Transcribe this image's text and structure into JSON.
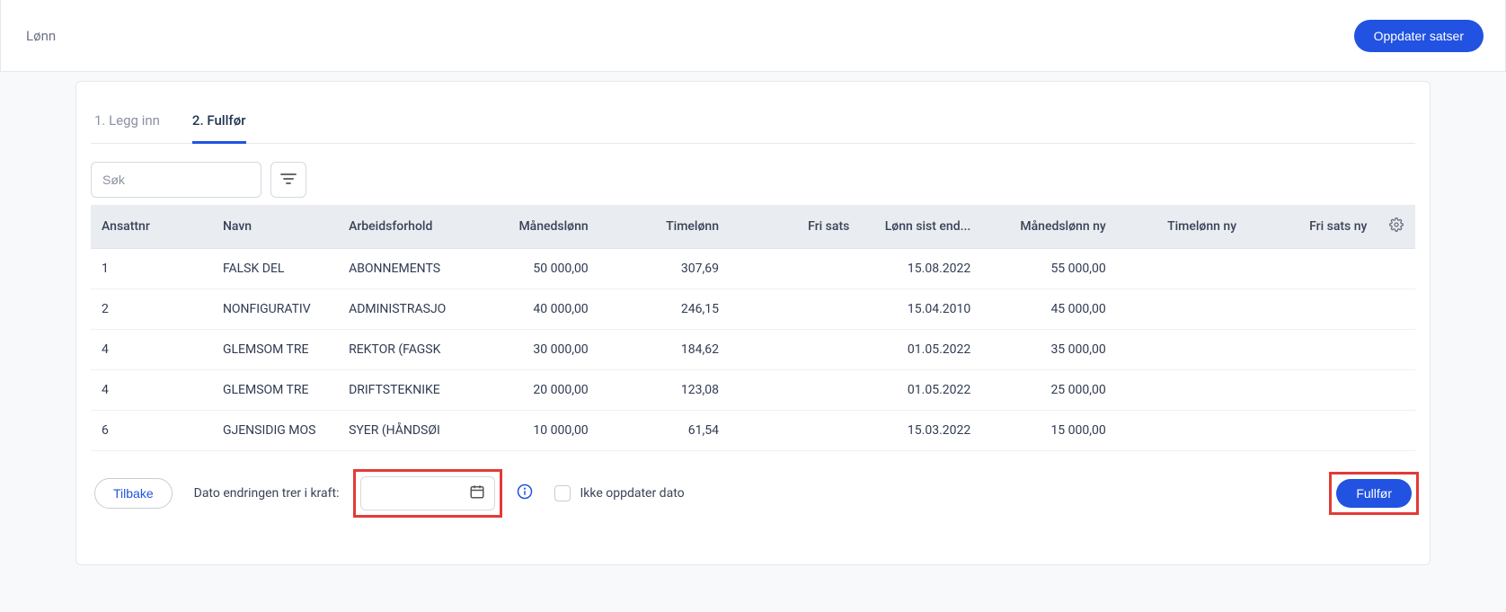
{
  "topbar": {
    "title": "Lønn",
    "update_rates_label": "Oppdater satser"
  },
  "tabs": [
    {
      "label": "1. Legg inn",
      "active": false
    },
    {
      "label": "2. Fullfør",
      "active": true
    }
  ],
  "toolbar": {
    "search_placeholder": "Søk",
    "search_value": "",
    "filter_icon": "filter-icon"
  },
  "table": {
    "headers": {
      "ansattnr": "Ansattnr",
      "navn": "Navn",
      "arbeidsforhold": "Arbeidsforhold",
      "manedslonn": "Månedslønn",
      "timelonn": "Timelønn",
      "fri_sats": "Fri sats",
      "lonn_sist_end": "Lønn sist end...",
      "manedslonn_ny": "Månedslønn ny",
      "timelonn_ny": "Timelønn ny",
      "fri_sats_ny": "Fri sats ny"
    },
    "rows": [
      {
        "ansattnr": "1",
        "navn": "FALSK DEL",
        "arbeidsforhold": "ABONNEMENTS",
        "manedslonn": "50 000,00",
        "timelonn": "307,69",
        "fri_sats": "",
        "lonn_sist_end": "15.08.2022",
        "manedslonn_ny": "55 000,00",
        "timelonn_ny": "",
        "fri_sats_ny": ""
      },
      {
        "ansattnr": "2",
        "navn": "NONFIGURATIV",
        "arbeidsforhold": "ADMINISTRASJO",
        "manedslonn": "40 000,00",
        "timelonn": "246,15",
        "fri_sats": "",
        "lonn_sist_end": "15.04.2010",
        "manedslonn_ny": "45 000,00",
        "timelonn_ny": "",
        "fri_sats_ny": ""
      },
      {
        "ansattnr": "4",
        "navn": "GLEMSOM TRE",
        "arbeidsforhold": "REKTOR (FAGSK",
        "manedslonn": "30 000,00",
        "timelonn": "184,62",
        "fri_sats": "",
        "lonn_sist_end": "01.05.2022",
        "manedslonn_ny": "35 000,00",
        "timelonn_ny": "",
        "fri_sats_ny": ""
      },
      {
        "ansattnr": "4",
        "navn": "GLEMSOM TRE",
        "arbeidsforhold": "DRIFTSTEKNIKE",
        "manedslonn": "20 000,00",
        "timelonn": "123,08",
        "fri_sats": "",
        "lonn_sist_end": "01.05.2022",
        "manedslonn_ny": "25 000,00",
        "timelonn_ny": "",
        "fri_sats_ny": ""
      },
      {
        "ansattnr": "6",
        "navn": "GJENSIDIG MOS",
        "arbeidsforhold": "SYER (HÅNDSØI",
        "manedslonn": "10 000,00",
        "timelonn": "61,54",
        "fri_sats": "",
        "lonn_sist_end": "15.03.2022",
        "manedslonn_ny": "15 000,00",
        "timelonn_ny": "",
        "fri_sats_ny": ""
      }
    ]
  },
  "footer": {
    "back_label": "Tilbake",
    "date_label": "Dato endringen trer i kraft:",
    "date_value": "",
    "checkbox_label": "Ikke oppdater dato",
    "checkbox_checked": false,
    "complete_label": "Fullfør"
  },
  "colors": {
    "primary": "#2152e2",
    "highlight": "#e23b36",
    "header_bg": "#e9edf2"
  }
}
